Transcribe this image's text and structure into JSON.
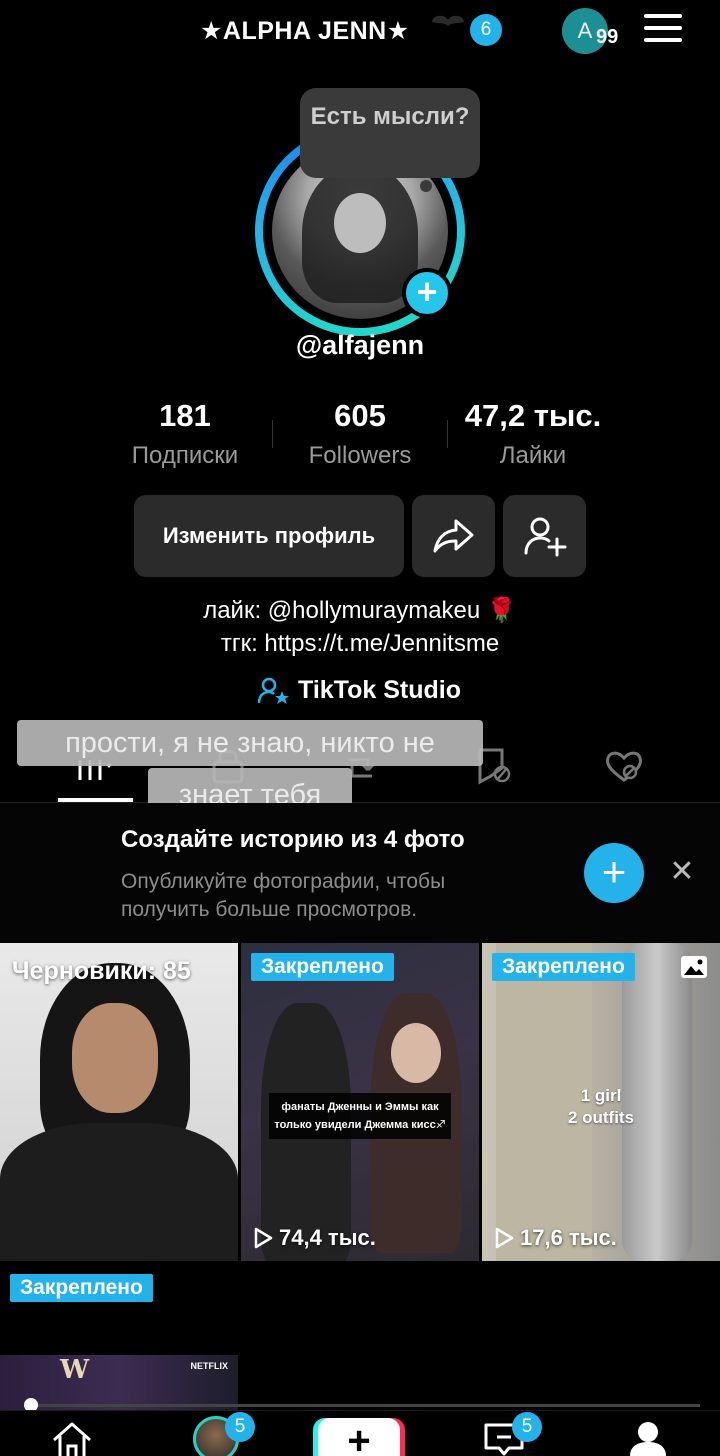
{
  "header": {
    "title": "★ALPHA JENN★",
    "notification_count": "6",
    "account_initial": "A",
    "account_count": "99"
  },
  "profile": {
    "thought_bubble": "Есть мысли?",
    "username": "@alfajenn",
    "stats": [
      {
        "value": "181",
        "label": "Подписки"
      },
      {
        "value": "605",
        "label": "Followers"
      },
      {
        "value": "47,2 тыс.",
        "label": "Лайки"
      }
    ],
    "edit_button": "Изменить профиль",
    "bio_line1": "лайк: @hollymuraymakeu 🌹",
    "bio_line2": "тгк: https://t.me/Jennitsme",
    "studio_link": "TikTok Studio"
  },
  "overlay_captions": {
    "line1": "прости, я не знаю, никто не",
    "line2": "знает тебя"
  },
  "promo": {
    "title": "Создайте историю из 4 фото",
    "subtitle": "Опубликуйте фотографии, чтобы получить больше просмотров."
  },
  "grid": {
    "tile1_label": "Черновики: 85",
    "pinned_label": "Закреплено",
    "tile2_caption": "фанаты Дженны и Эммы как только увидели Джемма кисс♐",
    "tile2_views": "74,4 тыс.",
    "tile3_text_line1": "1 girl",
    "tile3_text_line2": "2 outfits",
    "tile3_views": "17,6 тыс.",
    "tile4_brand": "NETFLIX",
    "tile4_letter": "W"
  },
  "bottom_nav": {
    "friends_badge": "5",
    "inbox_badge": "5",
    "create_symbol": "+"
  },
  "colors": {
    "accent": "#24b2eb",
    "ring_start": "#23d6c9",
    "background": "#000000",
    "button_bg": "#2b2b2b"
  }
}
